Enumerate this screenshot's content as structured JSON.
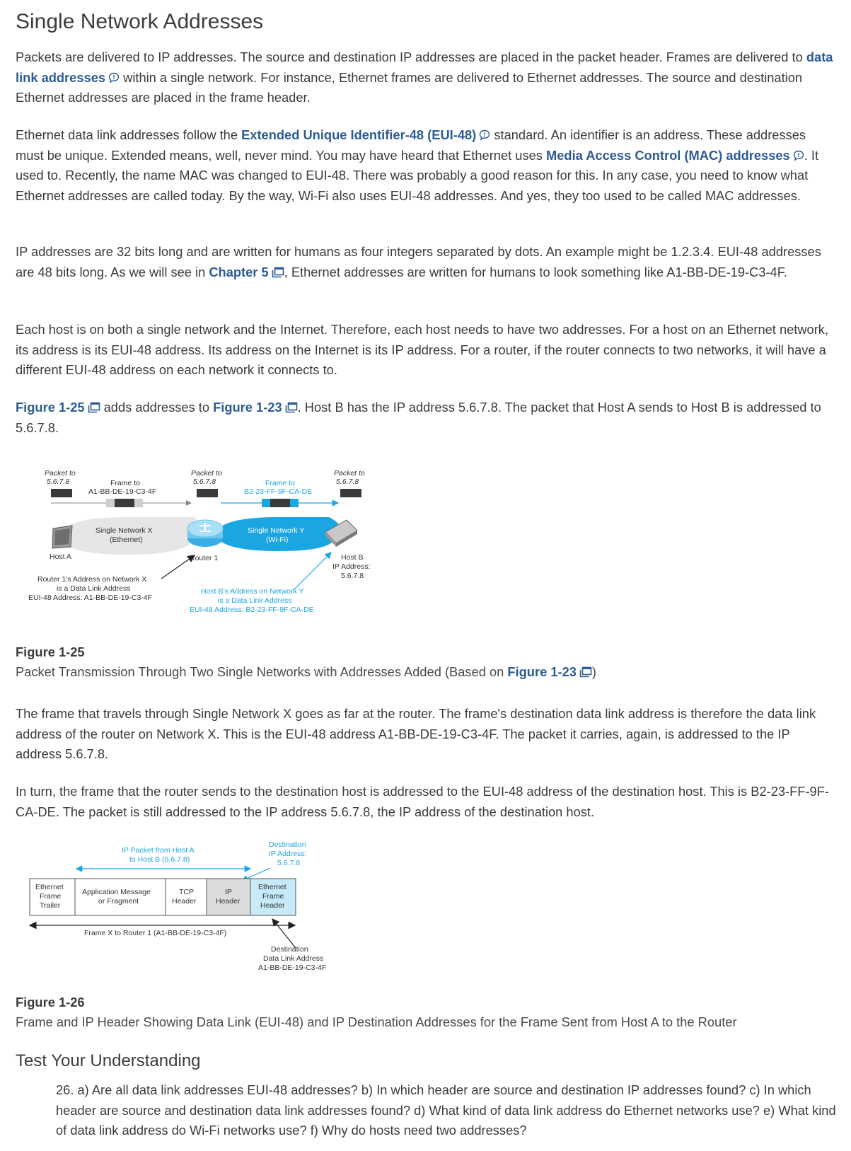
{
  "title": "Single Network Addresses",
  "p1": {
    "a": "Packets are delivered to IP addresses. The source and destination IP addresses are placed in the packet header. Frames are delivered to ",
    "term": "data link addresses",
    "b": " within a single network. For instance, Ethernet frames are delivered to Ethernet addresses. The source and destination Ethernet addresses are placed in the frame header."
  },
  "p2": {
    "a": "Ethernet data link addresses follow the ",
    "term1": "Extended Unique Identifier-48 (EUI-48)",
    "b": " standard. An identifier is an address. These addresses must be unique. Extended means, well, never mind. You may have heard that Ethernet uses ",
    "term2": "Media Access Control (MAC) addresses",
    "c": ". It used to. Recently, the name MAC was changed to EUI-48. There was probably a good reason for this. In any case, you need to know what Ethernet addresses are called today. By the way, Wi-Fi also uses EUI-48 addresses. And yes, they too used to be called MAC addresses."
  },
  "p3": {
    "a": "IP addresses are 32 bits long and are written for humans as four integers separated by dots. An example might be 1.2.3.4. EUI-48 addresses are 48 bits long. As we will see in ",
    "link": "Chapter 5",
    "b": ", Ethernet addresses are written for humans to look something like A1-BB-DE-19-C3-4F."
  },
  "p4": "Each host is on both a single network and the Internet. Therefore, each host needs to have two addresses. For a host on an Ethernet network, its address is its EUI-48 address. Its address on the Internet is its IP address. For a router, if the router connects to two networks, it will have a different EUI-48 address on each network it connects to.",
  "p5": {
    "link1": "Figure 1-25",
    "a": " adds addresses to ",
    "link2": "Figure 1-23",
    "b": ". Host B has the IP address 5.6.7.8. The packet that Host A sends to Host B is addressed to 5.6.7.8."
  },
  "fig25": {
    "packet_to": "Packet to",
    "ip": "5.6.7.8",
    "frame_to": "Frame to",
    "frame_x_addr": "A1-BB-DE-19-C3-4F",
    "frame_y_addr": "B2-23-FF-9F-CA-DE",
    "net_x_1": "Single Network X",
    "net_x_2": "(Ethernet)",
    "net_y_1": "Single Network Y",
    "net_y_2": "(Wi-Fi)",
    "host_a": "Host A",
    "router": "Router 1",
    "host_b_1": "Host B",
    "host_b_2": "IP Address:",
    "host_b_3": "5.6.7.8",
    "r_addr_1": "Router 1's Address on Network X",
    "r_addr_2": "is a Data Link Address",
    "r_addr_3": "EUI-48 Address: A1-BB-DE-19-C3-4F",
    "hb_addr_1": "Host B's Address on Network Y",
    "hb_addr_2": "is a Data Link Address",
    "hb_addr_3": "EUI-48 Address: B2-23-FF-9F-CA-DE",
    "label": "Figure 1-25",
    "caption_a": "Packet Transmission Through Two Single Networks with Addresses Added (Based on ",
    "caption_link": "Figure 1-23",
    "caption_b": ")"
  },
  "p6": "The frame that travels through Single Network X goes as far at the router. The frame's destination data link address is therefore the data link address of the router on Network X. This is the EUI-48 address A1-BB-DE-19-C3-4F. The packet it carries, again, is addressed to the IP address 5.6.7.8.",
  "p7": "In turn, the frame that the router sends to the destination host is addressed to the EUI-48 address of the destination host. This is B2-23-FF-9F-CA-DE. The packet is still addressed to the IP address 5.6.7.8, the IP address of the destination host.",
  "fig26": {
    "ip_packet_1": "IP Packet from Host A",
    "ip_packet_2": "to Host B (5.6.7.8)",
    "dest_ip_1": "Destination",
    "dest_ip_2": "IP Address:",
    "dest_ip_3": "5.6.7.8",
    "trailer": [
      "Ethernet",
      "Frame",
      "Trailer"
    ],
    "app_msg": [
      "Application Message",
      "or Fragment"
    ],
    "tcp": [
      "TCP",
      "Header"
    ],
    "iph": [
      "IP",
      "Header"
    ],
    "eth_hdr": [
      "Ethernet",
      "Frame",
      "Header"
    ],
    "frame_x": "Frame X to Router 1 (A1-BB-DE-19-C3-4F)",
    "dest_dl_1": "Destination",
    "dest_dl_2": "Data Link Address",
    "dest_dl_3": "A1-BB-DE-19-C3-4F",
    "label": "Figure 1-26",
    "caption": "Frame and IP Header Showing Data Link (EUI-48) and IP Destination Addresses for the Frame Sent from Host A to the Router"
  },
  "tyu": {
    "heading": "Test Your Understanding",
    "q26": "26. a) Are all data link addresses EUI-48 addresses? b) In which header are source and destination IP addresses found? c) In which header are source and destination data link addresses found? d) What kind of data link address do Ethernet networks use? e) What kind of data link address do Wi-Fi networks use? f) Why do hosts need two addresses?"
  },
  "colors": {
    "link": "#2c5c94",
    "wifi": "#1aa6e0",
    "text": "#3b3b3b"
  },
  "icons": {
    "glossary": "speech-bubble-icon",
    "crossref": "window-link-icon"
  }
}
